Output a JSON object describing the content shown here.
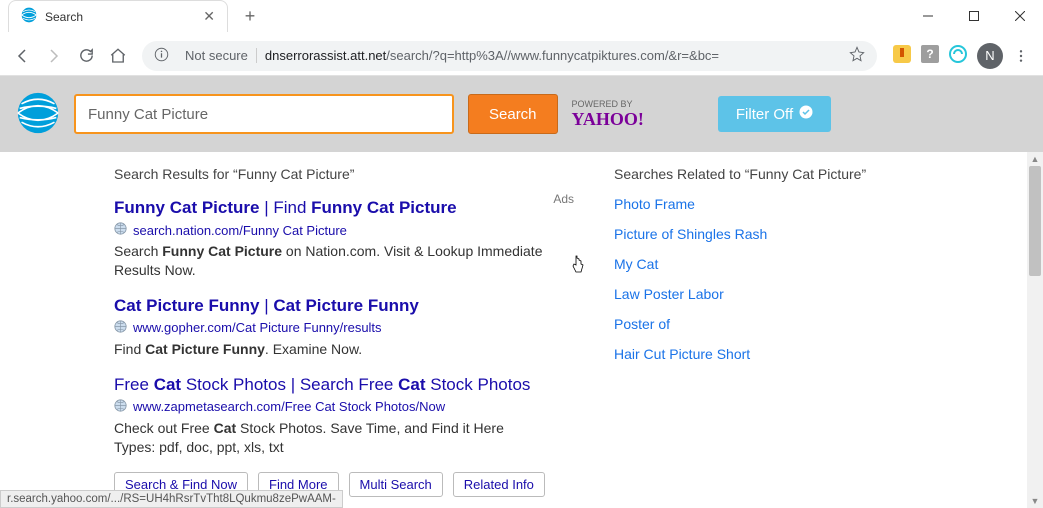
{
  "window": {
    "tab_title": "Search",
    "url_display_prefix": "dnserrorassist.att.net",
    "url_display_rest": "/search/?q=http%3A//www.funnycatpiktures.com/&r=&bc=",
    "not_secure": "Not secure",
    "avatar_letter": "N"
  },
  "search": {
    "query": "Funny Cat Picture",
    "button": "Search",
    "powered_label": "POWERED BY",
    "yahoo": "YAHOO!",
    "filter": "Filter Off"
  },
  "results_header": "Search Results for “Funny Cat Picture”",
  "ads_label": "Ads",
  "results": [
    {
      "title_html": "<b>Funny Cat Picture</b> | Find <b>Funny Cat Picture</b>",
      "url": "search.nation.com/Funny Cat Picture",
      "snippet_html": "Search <b>Funny Cat Picture</b> on Nation.com. Visit & Lookup Immediate Results Now."
    },
    {
      "title_html": "<b>Cat Picture Funny</b> | <b>Cat Picture Funny</b>",
      "url": "www.gopher.com/Cat Picture Funny/results",
      "snippet_html": "Find <b>Cat Picture Funny</b>. Examine Now."
    },
    {
      "title_html": "Free <b>Cat</b> Stock Photos | Search Free <b>Cat</b> Stock Photos",
      "url": "www.zapmetasearch.com/Free Cat Stock Photos/Now",
      "snippet_html": "Check out Free <b>Cat</b> Stock Photos. Save Time, and Find it Here",
      "types": "Types: pdf, doc, ppt, xls, txt"
    }
  ],
  "pill_buttons": [
    "Search & Find Now",
    "Find More",
    "Multi Search",
    "Related Info"
  ],
  "related_header": "Searches Related to “Funny Cat Picture”",
  "related": [
    "Photo Frame",
    "Picture of Shingles Rash",
    "My Cat",
    "Law Poster Labor",
    "Poster of",
    "Hair Cut Picture Short"
  ],
  "status_bar": "r.search.yahoo.com/.../RS=UH4hRsrTvTht8LQukmu8zePwAAM-"
}
